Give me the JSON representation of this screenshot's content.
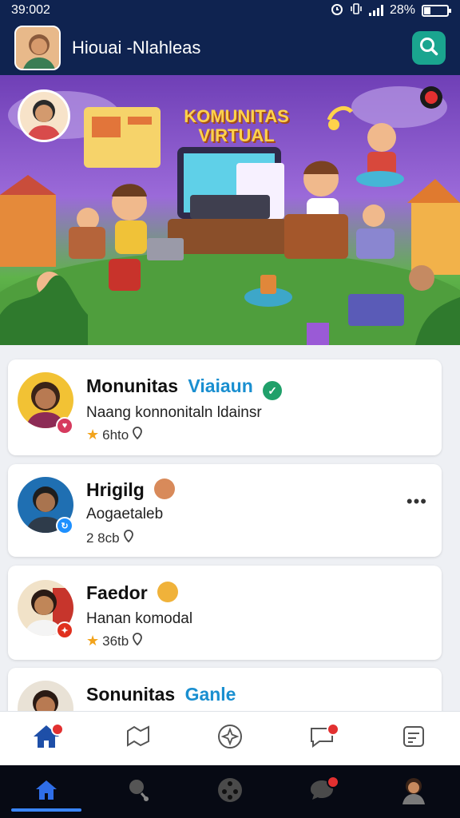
{
  "status_bar": {
    "time": "39:002",
    "icons": [
      "alarm-icon",
      "vibrate-icon",
      "signal-icon"
    ],
    "battery_text": "28%",
    "battery_level": 0.28
  },
  "header": {
    "title": "Hiouai -Nlahleas",
    "search_icon": "search-icon"
  },
  "banner": {
    "title_line1": "KOMUNITAS",
    "title_line2": "VIRTUAL"
  },
  "cards": [
    {
      "name": "Monunitas",
      "name_accent": "Viaiaun",
      "subtitle": "Naang konnonitaln ldainsr",
      "meta": "6hto",
      "badge_icon": "verified-icon",
      "accent": "#1a8fd0"
    },
    {
      "name": "Hrigilg",
      "subtitle": "Aogaetaleb",
      "meta": "2 8cb"
    },
    {
      "name": "Faedor",
      "subtitle": "Hanan komodal",
      "meta": "36tb"
    },
    {
      "name": "Sonunitas",
      "name_accent": "Ganle"
    }
  ],
  "bottom_nav": [
    "home-icon",
    "map-icon",
    "sparkle-icon",
    "chat-icon",
    "profile-icon"
  ],
  "system_nav": [
    "home-icon",
    "pin-icon",
    "film-icon",
    "chat-icon",
    "avatar-icon"
  ],
  "colors": {
    "header_bg": "#0f2350",
    "accent_teal": "#1aa58f",
    "accent_blue": "#1a8fd0",
    "notif_red": "#e23030"
  }
}
